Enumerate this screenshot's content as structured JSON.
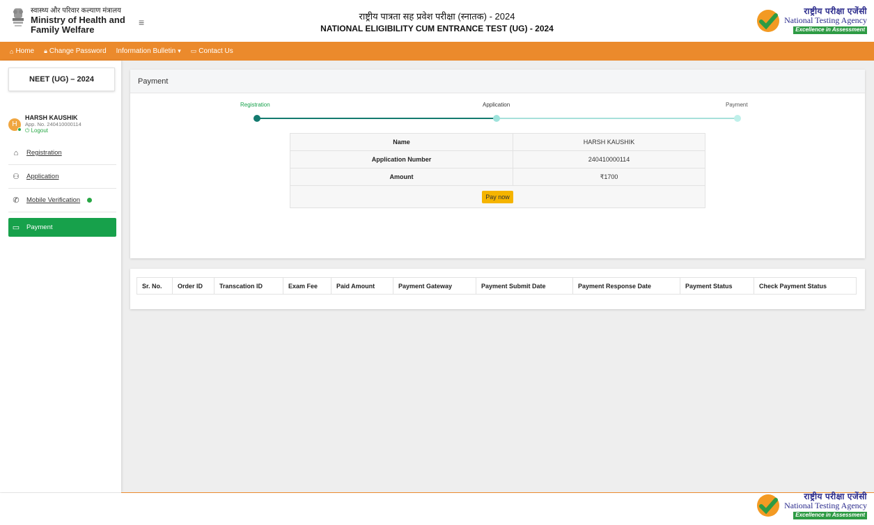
{
  "header": {
    "ministry_hindi": "स्वास्थ्य और परिवार कल्याण मंत्रालय",
    "ministry_en_line1": "Ministry of Health and",
    "ministry_en_line2": "Family Welfare",
    "title_hindi": "राष्ट्रीय पात्रता सह प्रवेश परीक्षा (स्नातक) - 2024",
    "title_en": "NATIONAL ELIGIBILITY CUM ENTRANCE TEST (UG) - 2024",
    "nta_hindi": "राष्ट्रीय परीक्षा एजेंसी",
    "nta_en": "National Testing Agency",
    "nta_tagline": "Excellence in Assessment"
  },
  "nav": {
    "home": "Home",
    "change_password": "Change Password",
    "information_bulletin": "Information Bulletin",
    "contact_us": "Contact Us"
  },
  "sidebar": {
    "exam": "NEET (UG) – 2024",
    "user_initial": "H",
    "user_name": "HARSH KAUSHIK",
    "app_no": "App. No. 240410000114",
    "logout": "Logout",
    "items": [
      {
        "label": "Registration"
      },
      {
        "label": "Application"
      },
      {
        "label": "Mobile Verification"
      },
      {
        "label": "Payment"
      }
    ]
  },
  "payment": {
    "heading": "Payment",
    "steps": [
      "Registration",
      "Application",
      "Payment"
    ],
    "rows": [
      {
        "label": "Name",
        "value": "HARSH KAUSHIK"
      },
      {
        "label": "Application Number",
        "value": "240410000114"
      },
      {
        "label": "Amount",
        "value": "₹1700"
      }
    ],
    "pay_button": "Pay now"
  },
  "transactions": {
    "columns": [
      "Sr. No.",
      "Order ID",
      "Transcation ID",
      "Exam Fee",
      "Paid Amount",
      "Payment Gateway",
      "Payment Submit Date",
      "Payment Response Date",
      "Payment Status",
      "Check Payment Status"
    ]
  },
  "colors": {
    "nav_orange": "#eb8a2c",
    "active_green": "#17a14b",
    "step_teal": "#137a6f",
    "pay_button": "#f5b400"
  }
}
